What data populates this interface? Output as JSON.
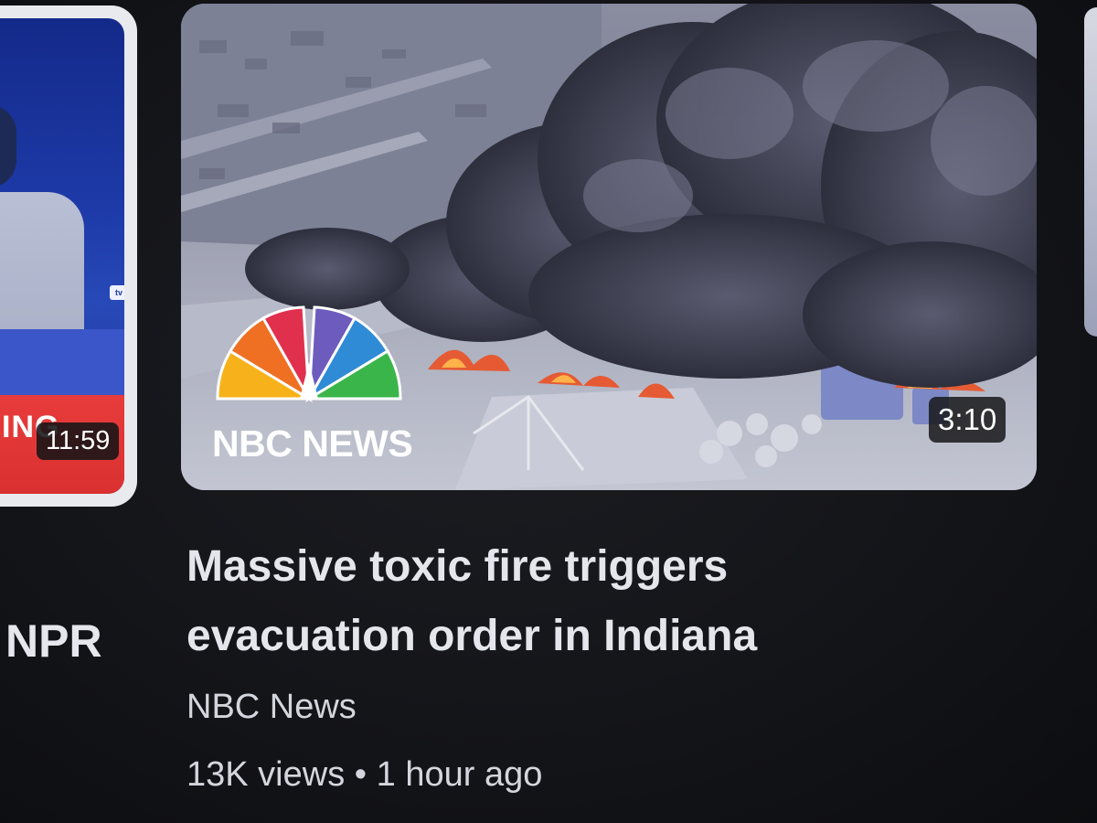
{
  "left_video": {
    "banner_text": "ING",
    "duration": "11:59",
    "channel_partial": "NPR"
  },
  "main_video": {
    "logo_text": "NBC NEWS",
    "duration": "3:10",
    "title": "Massive toxic fire triggers evacuation order in Indiana",
    "channel": "NBC News",
    "views": "13K views",
    "separator": "•",
    "time_ago": "1 hour ago"
  },
  "colors": {
    "background": "#141519",
    "text_primary": "#e4e6ec",
    "text_secondary": "#d4d6dd",
    "focus_border": "#e9eaee",
    "peacock": [
      "#f7b21b",
      "#ef6f23",
      "#e1304e",
      "#6d5bbd",
      "#2f8bd6",
      "#3ab54a"
    ]
  },
  "icons": [
    "nbc-peacock-logo",
    "tv-icon"
  ]
}
